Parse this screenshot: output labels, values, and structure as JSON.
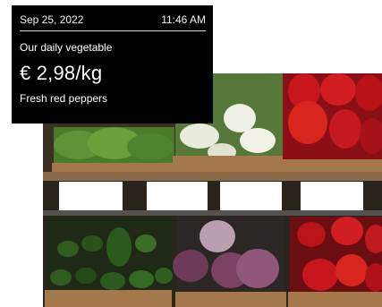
{
  "card": {
    "date": "Sep 25, 2022",
    "time": "11:46 AM",
    "headline": "Our daily vegetable",
    "price": "€ 2,98/kg",
    "product": "Fresh red peppers"
  },
  "colors": {
    "card_bg": "#000000",
    "card_text": "#ffffff",
    "pepper_red": "#c8161d",
    "crate_wood": "#a5784c",
    "zucchini_green": "#2f5e1e",
    "radicchio_purple": "#6d3a58"
  }
}
